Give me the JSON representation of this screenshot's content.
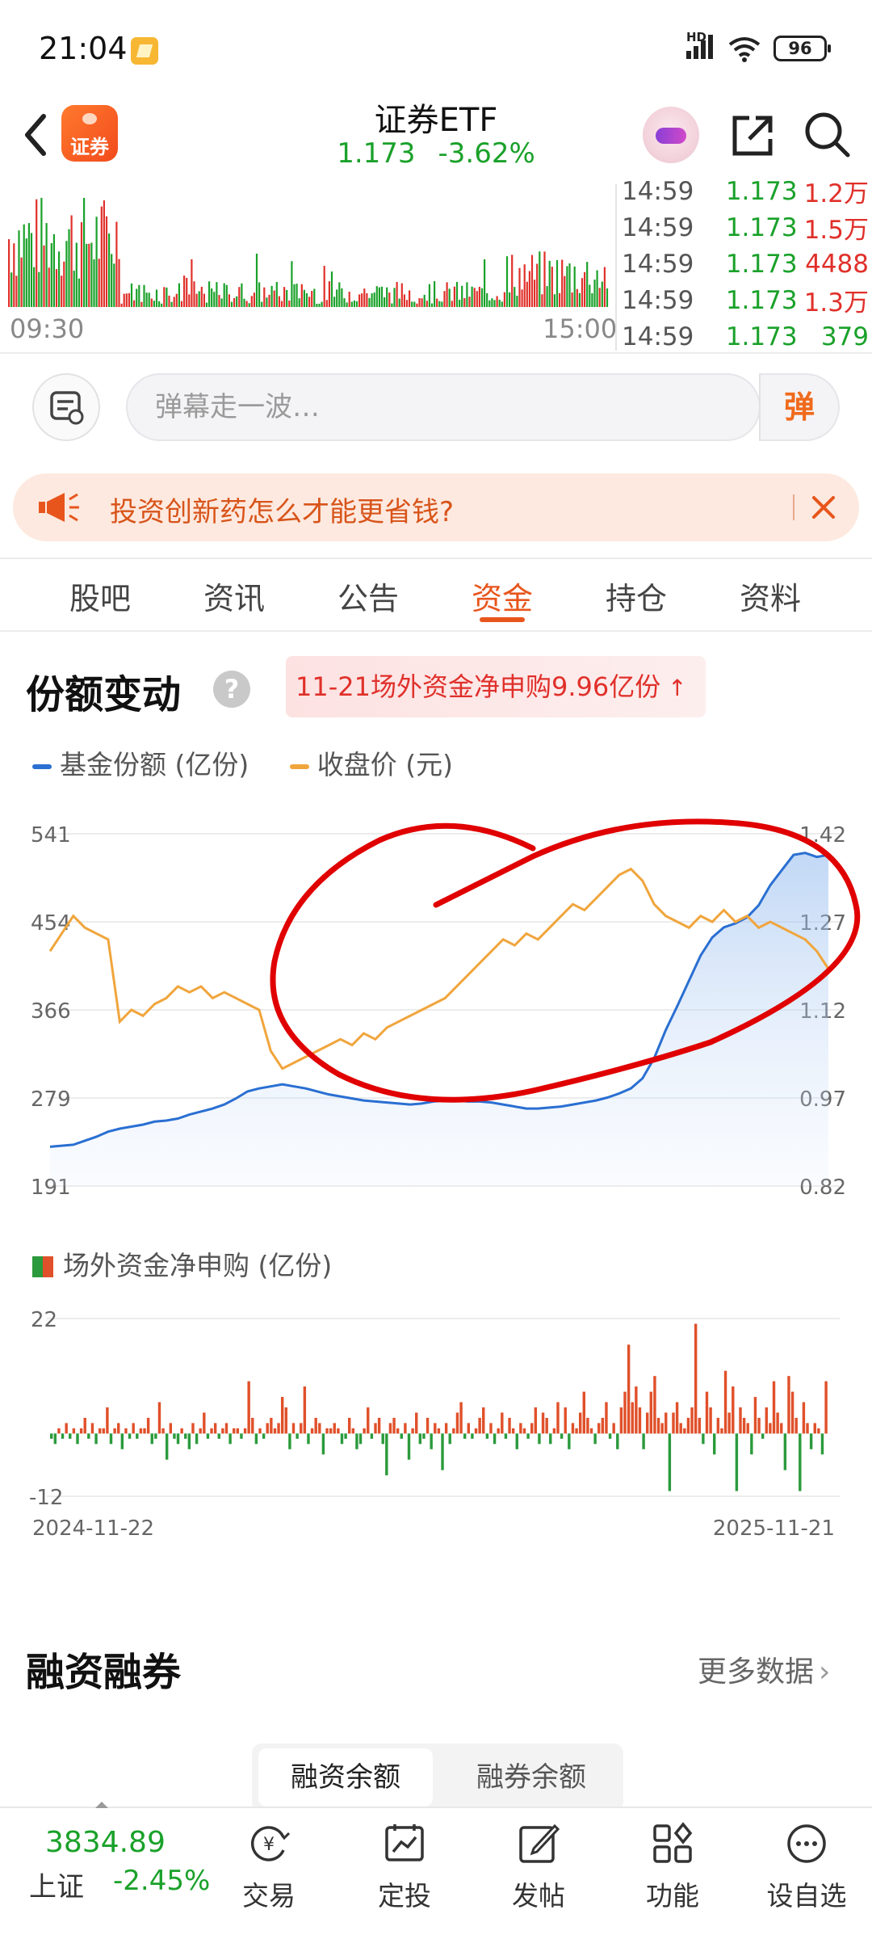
{
  "status_bar": {
    "time": "21:04",
    "battery": "96",
    "network": "HD"
  },
  "header": {
    "logo_text": "证券",
    "title": "证券ETF",
    "price": "1.173",
    "change": "-3.62%"
  },
  "ticks": {
    "time_start": "09:30",
    "time_end": "15:00",
    "rows": [
      {
        "time": "14:59",
        "price": "1.173",
        "volume": "1.2万",
        "side": "sell"
      },
      {
        "time": "14:59",
        "price": "1.173",
        "volume": "1.5万",
        "side": "sell"
      },
      {
        "time": "14:59",
        "price": "1.173",
        "volume": "4488",
        "side": "sell"
      },
      {
        "time": "14:59",
        "price": "1.173",
        "volume": "1.3万",
        "side": "sell"
      },
      {
        "time": "14:59",
        "price": "1.173",
        "volume": "379",
        "side": "buy"
      }
    ]
  },
  "danmaku": {
    "placeholder": "弹幕走一波…",
    "send_label": "弹"
  },
  "promo": {
    "text": "投资创新药怎么才能更省钱?"
  },
  "tabs": [
    {
      "label": "股吧",
      "active": false
    },
    {
      "label": "资讯",
      "active": false
    },
    {
      "label": "公告",
      "active": false
    },
    {
      "label": "资金",
      "active": true
    },
    {
      "label": "持仓",
      "active": false
    },
    {
      "label": "资料",
      "active": false
    }
  ],
  "share_section": {
    "title": "份额变动",
    "badge": "11-21场外资金净申购9.96亿份",
    "legend": {
      "share": "基金份额 (亿份)",
      "close": "收盘价 (元)"
    },
    "flow_legend": "场外资金净申购 (亿份)"
  },
  "chart_data": [
    {
      "type": "line",
      "title": "",
      "series": [
        {
          "name": "基金份额 (亿份)",
          "axis": "left",
          "color": "#2a6fd2",
          "values": [
            230,
            231,
            232,
            236,
            240,
            245,
            248,
            250,
            252,
            255,
            256,
            258,
            262,
            265,
            268,
            272,
            278,
            285,
            288,
            290,
            292,
            290,
            288,
            285,
            282,
            280,
            278,
            276,
            275,
            274,
            273,
            272,
            273,
            275,
            276,
            276,
            275,
            275,
            274,
            272,
            270,
            268,
            268,
            269,
            270,
            272,
            274,
            276,
            279,
            283,
            288,
            298,
            318,
            346,
            370,
            395,
            420,
            438,
            448,
            452,
            458,
            470,
            490,
            505,
            520,
            522,
            518,
            520
          ]
        },
        {
          "name": "收盘价 (元)",
          "axis": "right",
          "color": "#f0a53c",
          "values": [
            1.22,
            1.25,
            1.28,
            1.26,
            1.25,
            1.24,
            1.1,
            1.12,
            1.11,
            1.13,
            1.14,
            1.16,
            1.15,
            1.16,
            1.14,
            1.15,
            1.14,
            1.13,
            1.12,
            1.05,
            1.02,
            1.03,
            1.04,
            1.05,
            1.06,
            1.07,
            1.06,
            1.08,
            1.07,
            1.09,
            1.1,
            1.11,
            1.12,
            1.13,
            1.14,
            1.16,
            1.18,
            1.2,
            1.22,
            1.24,
            1.23,
            1.25,
            1.24,
            1.26,
            1.28,
            1.3,
            1.29,
            1.31,
            1.33,
            1.35,
            1.36,
            1.34,
            1.3,
            1.28,
            1.27,
            1.26,
            1.28,
            1.27,
            1.29,
            1.27,
            1.28,
            1.26,
            1.27,
            1.26,
            1.25,
            1.24,
            1.22,
            1.19
          ]
        }
      ],
      "y_left": {
        "min": 191,
        "max": 541,
        "ticks": [
          "541",
          "454",
          "366",
          "279",
          "191"
        ]
      },
      "y_right": {
        "min": 0.82,
        "max": 1.42,
        "ticks": [
          "1.42",
          "1.27",
          "1.12",
          "0.97",
          "0.82"
        ]
      },
      "grid": true,
      "legend": "top-left"
    },
    {
      "type": "bar",
      "title": "",
      "series": [
        {
          "name": "场外资金净申购 (亿份)",
          "values": [
            -1,
            -2,
            1,
            -1,
            2,
            -1,
            1,
            -2,
            1,
            3,
            -1,
            2,
            -2,
            1,
            1,
            5,
            -2,
            1,
            2,
            -3,
            1,
            -1,
            2,
            -1,
            1,
            1,
            3,
            -2,
            -1,
            6,
            1,
            -5,
            2,
            -1,
            -2,
            1,
            -1,
            -3,
            2,
            -2,
            1,
            4,
            -1,
            1,
            2,
            -1,
            1,
            2,
            -2,
            1,
            1,
            -1,
            1,
            10,
            3,
            -2,
            1,
            -1,
            2,
            3,
            1,
            2,
            7,
            5,
            -3,
            2,
            -1,
            2,
            9,
            -2,
            1,
            3,
            2,
            -4,
            1,
            1,
            2,
            1,
            -2,
            -1,
            3,
            1,
            -3,
            -2,
            1,
            5,
            -1,
            2,
            3,
            -2,
            -8,
            2,
            3,
            1,
            -1,
            2,
            -5,
            1,
            4,
            -2,
            -1,
            3,
            -3,
            2,
            1,
            -7,
            2,
            -2,
            1,
            4,
            6,
            -1,
            2,
            -1,
            1,
            3,
            5,
            -1,
            2,
            -2,
            1,
            4,
            -1,
            3,
            1,
            -3,
            2,
            1,
            -1,
            2,
            5,
            -2,
            4,
            3,
            -2,
            1,
            6,
            -1,
            5,
            -3,
            2,
            1,
            4,
            8,
            3,
            1,
            -2,
            2,
            3,
            6,
            -1,
            2,
            -3,
            5,
            8,
            17,
            6,
            9,
            5,
            -3,
            4,
            8,
            11,
            3,
            2,
            4,
            -11,
            4,
            6,
            2,
            1,
            3,
            5,
            21,
            3,
            -2,
            8,
            5,
            -4,
            3,
            1,
            12,
            4,
            9,
            -11,
            5,
            3,
            2,
            -4,
            7,
            3,
            -1,
            5,
            2,
            10,
            4,
            2,
            -7,
            11,
            8,
            3,
            -11,
            6,
            2,
            -3,
            2,
            1,
            -4,
            10
          ]
        }
      ],
      "x_start": "2024-11-22",
      "x_end": "2025-11-21",
      "ylim": [
        -12,
        22
      ],
      "y_ticks": [
        "22",
        "-12"
      ],
      "colors": {
        "positive": "#e0502a",
        "negative": "#2b9a3c"
      }
    }
  ],
  "margin_section": {
    "title": "融资融券",
    "more_label": "更多数据",
    "tabs": [
      "融资余额",
      "融券余额"
    ]
  },
  "bottom_bar": {
    "index_value": "3834.89",
    "index_name": "上证",
    "index_change": "-2.45%",
    "nav": [
      {
        "label": "交易",
        "icon": "trade-icon"
      },
      {
        "label": "定投",
        "icon": "invest-plan-icon"
      },
      {
        "label": "发帖",
        "icon": "post-icon"
      },
      {
        "label": "功能",
        "icon": "apps-icon"
      },
      {
        "label": "设自选",
        "icon": "add-watchlist-icon"
      }
    ]
  },
  "colors": {
    "up": "#e0302a",
    "down": "#1aa12a",
    "accent": "#e8551c",
    "annotation": "#e00000"
  }
}
